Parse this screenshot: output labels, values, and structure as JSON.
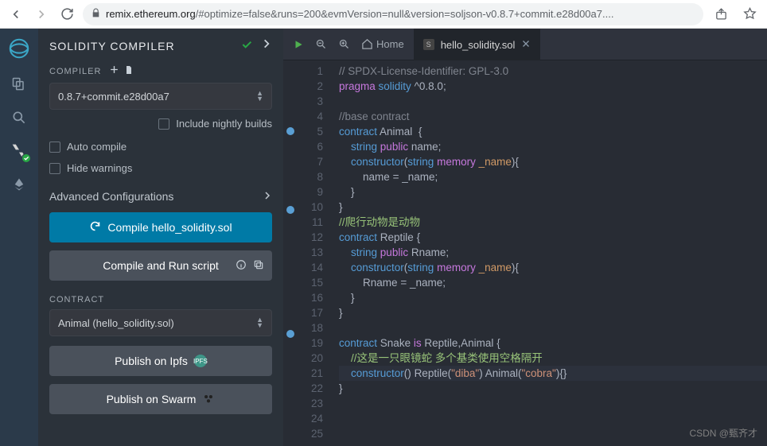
{
  "browser": {
    "url_domain": "remix.ethereum.org",
    "url_path": "/#optimize=false&runs=200&evmVersion=null&version=soljson-v0.8.7+commit.e28d00a7...."
  },
  "sidebar": {
    "title": "SOLIDITY COMPILER",
    "compiler_label": "COMPILER",
    "compiler_value": "0.8.7+commit.e28d00a7",
    "include_nightly": "Include nightly builds",
    "auto_compile": "Auto compile",
    "hide_warnings": "Hide warnings",
    "advanced": "Advanced Configurations",
    "compile_btn": "Compile hello_solidity.sol",
    "compile_run_btn": "Compile and Run script",
    "contract_label": "CONTRACT",
    "contract_value": "Animal (hello_solidity.sol)",
    "publish_ipfs": "Publish on Ipfs",
    "publish_swarm": "Publish on Swarm"
  },
  "editor": {
    "home_label": "Home",
    "tab_name": "hello_solidity.sol",
    "watermark": "CSDN @甄齐才",
    "lines": [
      {
        "n": 1,
        "bp": false,
        "html": "<span class='tk-comment'>// SPDX-License-Identifier: GPL-3.0</span>"
      },
      {
        "n": 2,
        "bp": false,
        "html": "<span class='tk-kw'>pragma</span> <span class='tk-type'>solidity</span> <span class='tk-name'>^0.8.0</span><span class='tk-punct'>;</span>"
      },
      {
        "n": 3,
        "bp": false,
        "html": ""
      },
      {
        "n": 4,
        "bp": false,
        "html": "<span class='tk-comment'>//base contract</span>"
      },
      {
        "n": 5,
        "bp": true,
        "html": "<span class='tk-kw2'>contract</span> <span class='tk-name'>Animal</span>  <span class='tk-punct'>{</span>"
      },
      {
        "n": 6,
        "bp": false,
        "html": "    <span class='tk-kw2'>string</span> <span class='tk-kw'>public</span> <span class='tk-name'>name</span><span class='tk-punct'>;</span>"
      },
      {
        "n": 7,
        "bp": false,
        "html": "    <span class='tk-ctr'>constructor</span><span class='tk-punct'>(</span><span class='tk-kw2'>string</span> <span class='tk-mem'>memory</span> <span class='tk-param'>_name</span><span class='tk-punct'>){</span>"
      },
      {
        "n": 8,
        "bp": false,
        "html": "        <span class='tk-name'>name</span> <span class='tk-punct'>=</span> <span class='tk-name'>_name</span><span class='tk-punct'>;</span>"
      },
      {
        "n": 9,
        "bp": false,
        "html": "    <span class='tk-punct'>}</span>"
      },
      {
        "n": 10,
        "bp": true,
        "html": "<span class='tk-punct'>}</span>"
      },
      {
        "n": 11,
        "bp": false,
        "html": "<span class='tk-comment-cn'>//爬行动物是动物</span>"
      },
      {
        "n": 12,
        "bp": false,
        "html": "<span class='tk-kw2'>contract</span> <span class='tk-name'>Reptile</span> <span class='tk-punct'>{</span>"
      },
      {
        "n": 13,
        "bp": false,
        "html": "    <span class='tk-kw2'>string</span> <span class='tk-kw'>public</span> <span class='tk-name'>Rname</span><span class='tk-punct'>;</span>"
      },
      {
        "n": 14,
        "bp": false,
        "html": "    <span class='tk-ctr'>constructor</span><span class='tk-punct'>(</span><span class='tk-kw2'>string</span> <span class='tk-mem'>memory</span> <span class='tk-param'>_name</span><span class='tk-punct'>){</span>"
      },
      {
        "n": 15,
        "bp": false,
        "html": "        <span class='tk-name'>Rname</span> <span class='tk-punct'>=</span> <span class='tk-name'>_name</span><span class='tk-punct'>;</span>"
      },
      {
        "n": 16,
        "bp": false,
        "html": "    <span class='tk-punct'>}</span>"
      },
      {
        "n": 17,
        "bp": false,
        "html": "<span class='tk-punct'>}</span>"
      },
      {
        "n": 18,
        "bp": true,
        "html": ""
      },
      {
        "n": 19,
        "bp": false,
        "html": "<span class='tk-kw2'>contract</span> <span class='tk-name'>Snake</span> <span class='tk-kw'>is</span> <span class='tk-name'>Reptile</span><span class='tk-punct'>,</span><span class='tk-name'>Animal</span> <span class='tk-punct'>{</span>"
      },
      {
        "n": 20,
        "bp": false,
        "html": "    <span class='tk-comment-cn'>//这是一只眼镜蛇 多个基类使用空格隔开</span>"
      },
      {
        "n": 21,
        "bp": false,
        "cursor": true,
        "html": "    <span class='tk-ctr'>constructor</span><span class='tk-punct'>()</span> <span class='tk-name'>Reptile</span><span class='tk-punct'>(</span><span class='tk-str'>\"diba\"</span><span class='tk-punct'>)</span> <span class='tk-name'>Animal</span><span class='tk-punct'>(</span><span class='tk-str'>\"cobra\"</span><span class='tk-punct'>){}</span>"
      },
      {
        "n": 22,
        "bp": false,
        "html": "<span class='tk-punct'>}</span>"
      },
      {
        "n": 23,
        "bp": false,
        "html": ""
      },
      {
        "n": 24,
        "bp": false,
        "html": ""
      },
      {
        "n": 25,
        "bp": false,
        "html": ""
      }
    ]
  }
}
